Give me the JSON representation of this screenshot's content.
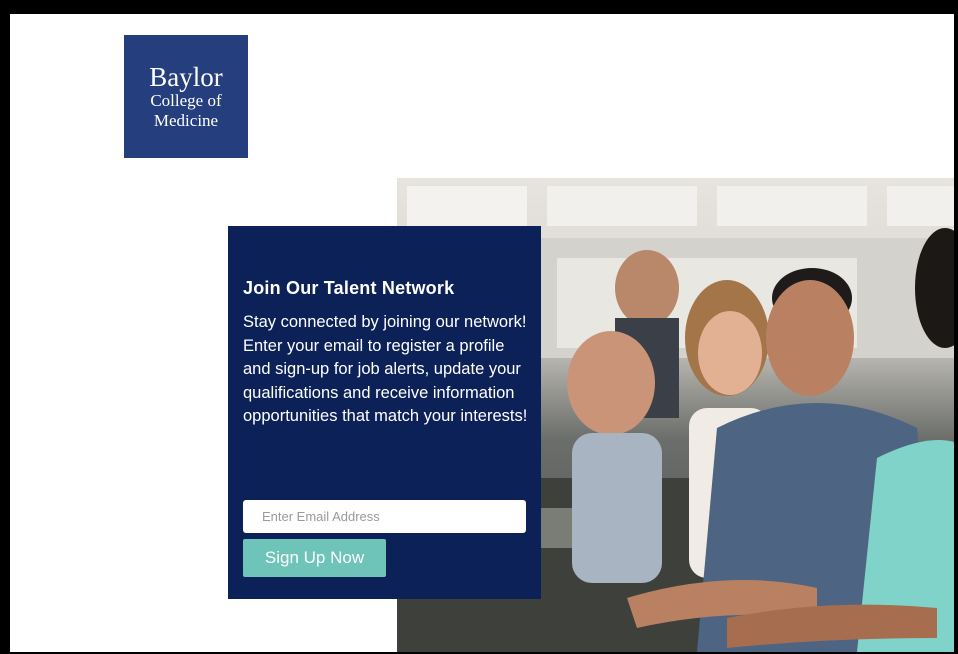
{
  "logo": {
    "line1": "Baylor",
    "line2": "College of",
    "line3": "Medicine"
  },
  "talent_card": {
    "title": "Join Our Talent Network",
    "body": "Stay connected by joining our network! Enter your email to register a profile and  sign-up for job alerts, update your qualifications and receive information opportunities that match your interests!",
    "email_placeholder": "Enter Email Address",
    "signup_label": "Sign Up Now"
  },
  "colors": {
    "logo_bg": "#253e7e",
    "card_bg": "#0c2158",
    "button_bg": "#6ec4b9"
  }
}
